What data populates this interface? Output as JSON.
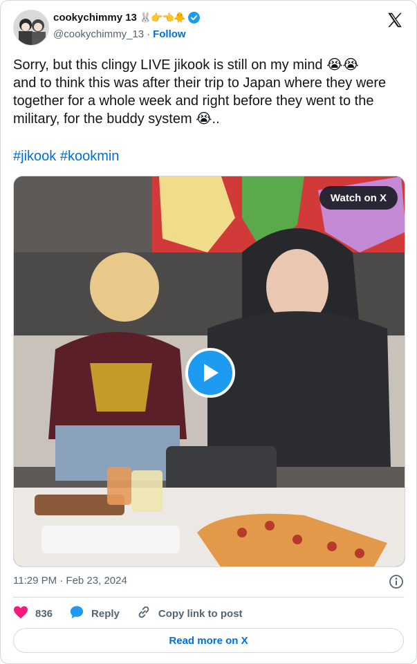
{
  "colors": {
    "accent": "#1d9bf0",
    "link": "#006fd6",
    "like": "#f91880",
    "muted": "#536471"
  },
  "author": {
    "display_name": "cookychimmy 13",
    "name_emojis": "🐰👉👈🐥",
    "handle": "@cookychimmy_13",
    "separator": "·",
    "follow_label": "Follow",
    "verified_icon": "verified-badge-icon",
    "avatar_icon": "avatar-photo"
  },
  "brand_icon": "x-logo-icon",
  "tweet": {
    "text": "Sorry, but this clingy LIVE jikook is still on my mind 😭😭\nand to think this was after their trip to Japan where they were together for a whole week and right before they went to the military, for the buddy system 😭..",
    "hashtags": [
      "#jikook",
      "#kookmin"
    ]
  },
  "media": {
    "watch_label": "Watch on X",
    "play_icon": "play-icon"
  },
  "meta": {
    "timestamp": "11:29 PM · Feb 23, 2024",
    "info_icon": "info-icon"
  },
  "actions": {
    "like_count": "836",
    "reply_label": "Reply",
    "copy_label": "Copy link to post"
  },
  "read_more_label": "Read more on X"
}
